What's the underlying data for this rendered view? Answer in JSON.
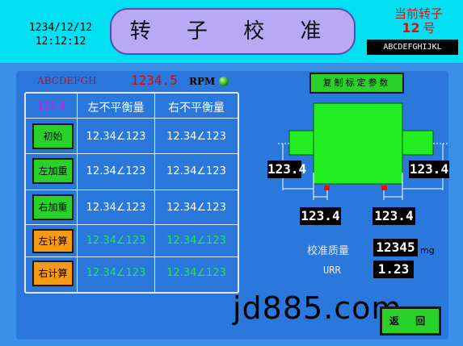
{
  "header": {
    "date": "1234/12/12",
    "time": "12:12:12",
    "title": "转 子 校 准",
    "rotor_label": "当前转子",
    "rotor_number": "12",
    "rotor_unit": "号",
    "code": "ABCDEFGHIJKL"
  },
  "status": {
    "label": "ABCDEFGH",
    "rpm_value": "1234.5",
    "rpm_unit": "RPM"
  },
  "table": {
    "corner_value": "123.4",
    "col_left": "左不平衡量",
    "col_right": "右不平衡量",
    "rows": [
      {
        "button": "初始",
        "button_color": "green",
        "left": "12.34∠123",
        "right": "12.34∠123",
        "value_color": "white"
      },
      {
        "button": "左加重",
        "button_color": "green",
        "left": "12.34∠123",
        "right": "12.34∠123",
        "value_color": "white"
      },
      {
        "button": "右加重",
        "button_color": "green",
        "left": "12.34∠123",
        "right": "12.34∠123",
        "value_color": "white"
      },
      {
        "button": "左计算",
        "button_color": "orange",
        "left": "12.34∠123",
        "right": "12.34∠123",
        "value_color": "green"
      },
      {
        "button": "右计算",
        "button_color": "orange",
        "left": "12.34∠123",
        "right": "12.34∠123",
        "value_color": "green"
      }
    ]
  },
  "rotor": {
    "copy_button": "复制标定参数",
    "left_dim": "123.4",
    "right_dim": "123.4",
    "bottom_left": "123.4",
    "bottom_right": "123.4",
    "mass_label": "校准质量",
    "mass_value": "12345",
    "mass_unit": "mg",
    "urr_label": "URR",
    "urr_value": "1.23"
  },
  "footer": {
    "back_button": "返 回",
    "watermark": "jd885.com"
  },
  "colors": {
    "background": "#3a8fe6",
    "header": "#00e0f0",
    "title_pill": "#b7a9f3",
    "button_green": "#28d228",
    "button_orange": "#f49a16",
    "rotor_green": "#22ee22",
    "value_green": "#23e35a",
    "alert_red": "#d20a0a"
  }
}
